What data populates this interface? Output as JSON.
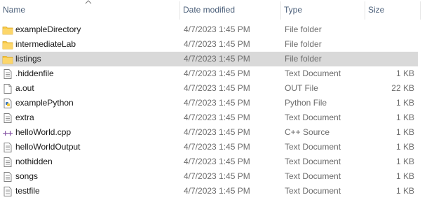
{
  "columns": {
    "name": "Name",
    "date_modified": "Date modified",
    "type": "Type",
    "size": "Size"
  },
  "sort": {
    "column": "name",
    "direction": "ascending",
    "icon": "chevron-up-icon"
  },
  "files": [
    {
      "name": "exampleDirectory",
      "date": "4/7/2023 1:45 PM",
      "type": "File folder",
      "size": "",
      "icon": "folder-icon",
      "selected": false
    },
    {
      "name": "intermediateLab",
      "date": "4/7/2023 1:45 PM",
      "type": "File folder",
      "size": "",
      "icon": "folder-icon",
      "selected": false
    },
    {
      "name": "listings",
      "date": "4/7/2023 1:45 PM",
      "type": "File folder",
      "size": "",
      "icon": "folder-icon",
      "selected": true
    },
    {
      "name": ".hiddenfile",
      "date": "4/7/2023 1:45 PM",
      "type": "Text Document",
      "size": "1 KB",
      "icon": "text-document-icon",
      "selected": false
    },
    {
      "name": "a.out",
      "date": "4/7/2023 1:45 PM",
      "type": "OUT File",
      "size": "22 KB",
      "icon": "blank-file-icon",
      "selected": false
    },
    {
      "name": "examplePython",
      "date": "4/7/2023 1:45 PM",
      "type": "Python File",
      "size": "1 KB",
      "icon": "python-file-icon",
      "selected": false
    },
    {
      "name": "extra",
      "date": "4/7/2023 1:45 PM",
      "type": "Text Document",
      "size": "1 KB",
      "icon": "text-document-icon",
      "selected": false
    },
    {
      "name": "helloWorld.cpp",
      "date": "4/7/2023 1:45 PM",
      "type": "C++ Source",
      "size": "1 KB",
      "icon": "cpp-source-icon",
      "selected": false
    },
    {
      "name": "helloWorldOutput",
      "date": "4/7/2023 1:45 PM",
      "type": "Text Document",
      "size": "1 KB",
      "icon": "text-document-icon",
      "selected": false
    },
    {
      "name": "nothidden",
      "date": "4/7/2023 1:45 PM",
      "type": "Text Document",
      "size": "1 KB",
      "icon": "text-document-icon",
      "selected": false
    },
    {
      "name": "songs",
      "date": "4/7/2023 1:45 PM",
      "type": "Text Document",
      "size": "1 KB",
      "icon": "text-document-icon",
      "selected": false
    },
    {
      "name": "testfile",
      "date": "4/7/2023 1:45 PM",
      "type": "Text Document",
      "size": "1 KB",
      "icon": "text-document-icon",
      "selected": false
    }
  ],
  "colors": {
    "header_text": "#4c607a",
    "selected_row": "#d9d9d9",
    "folder": "#f8c945",
    "secondary_text": "#6d6d6d"
  }
}
